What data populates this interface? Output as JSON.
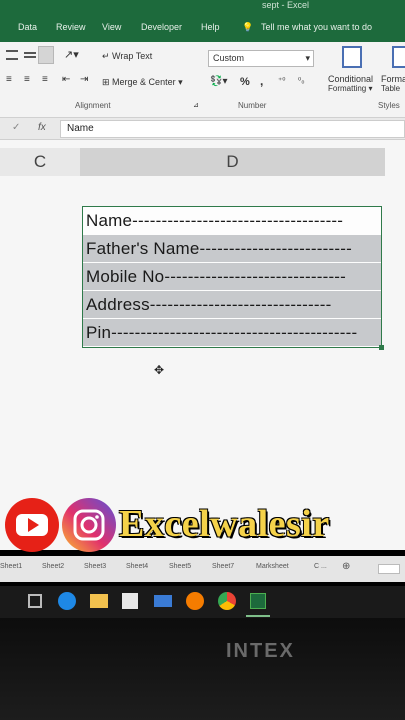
{
  "titlebar": {
    "text": "sept - Excel"
  },
  "menu": {
    "items": [
      "Data",
      "Review",
      "View",
      "Developer",
      "Help"
    ],
    "tell_me": "Tell me what you want to do"
  },
  "ribbon": {
    "wrap_text": "Wrap Text",
    "merge_center": "Merge & Center",
    "number_format": "Custom",
    "percent": "%",
    "comma": ",",
    "alignment_label": "Alignment",
    "number_label": "Number",
    "styles_label": "Styles",
    "conditional_formatting": "Conditional",
    "conditional_formatting2": "Formatting",
    "format_as_table": "Forma",
    "format_as_table2": "Table"
  },
  "formula_bar": {
    "cancel": "✓",
    "fx": "fx",
    "content": "Name"
  },
  "columns": [
    "C",
    "D"
  ],
  "cells": [
    "Name------------------------------------",
    "Father's Name--------------------------",
    "Mobile No-------------------------------",
    "Address-------------------------------",
    "Pin------------------------------------------"
  ],
  "brand": {
    "text": "Excelwalesir",
    "youtube_color": "#e62117",
    "text_color": "#f5d24a"
  },
  "sheet_tabs": [
    "Sheet1",
    "Sheet2",
    "Sheet3",
    "Sheet4",
    "Sheet5",
    "Sheet7",
    "Marksheet",
    "C ..."
  ],
  "bezel": {
    "logo": "INTEX"
  }
}
